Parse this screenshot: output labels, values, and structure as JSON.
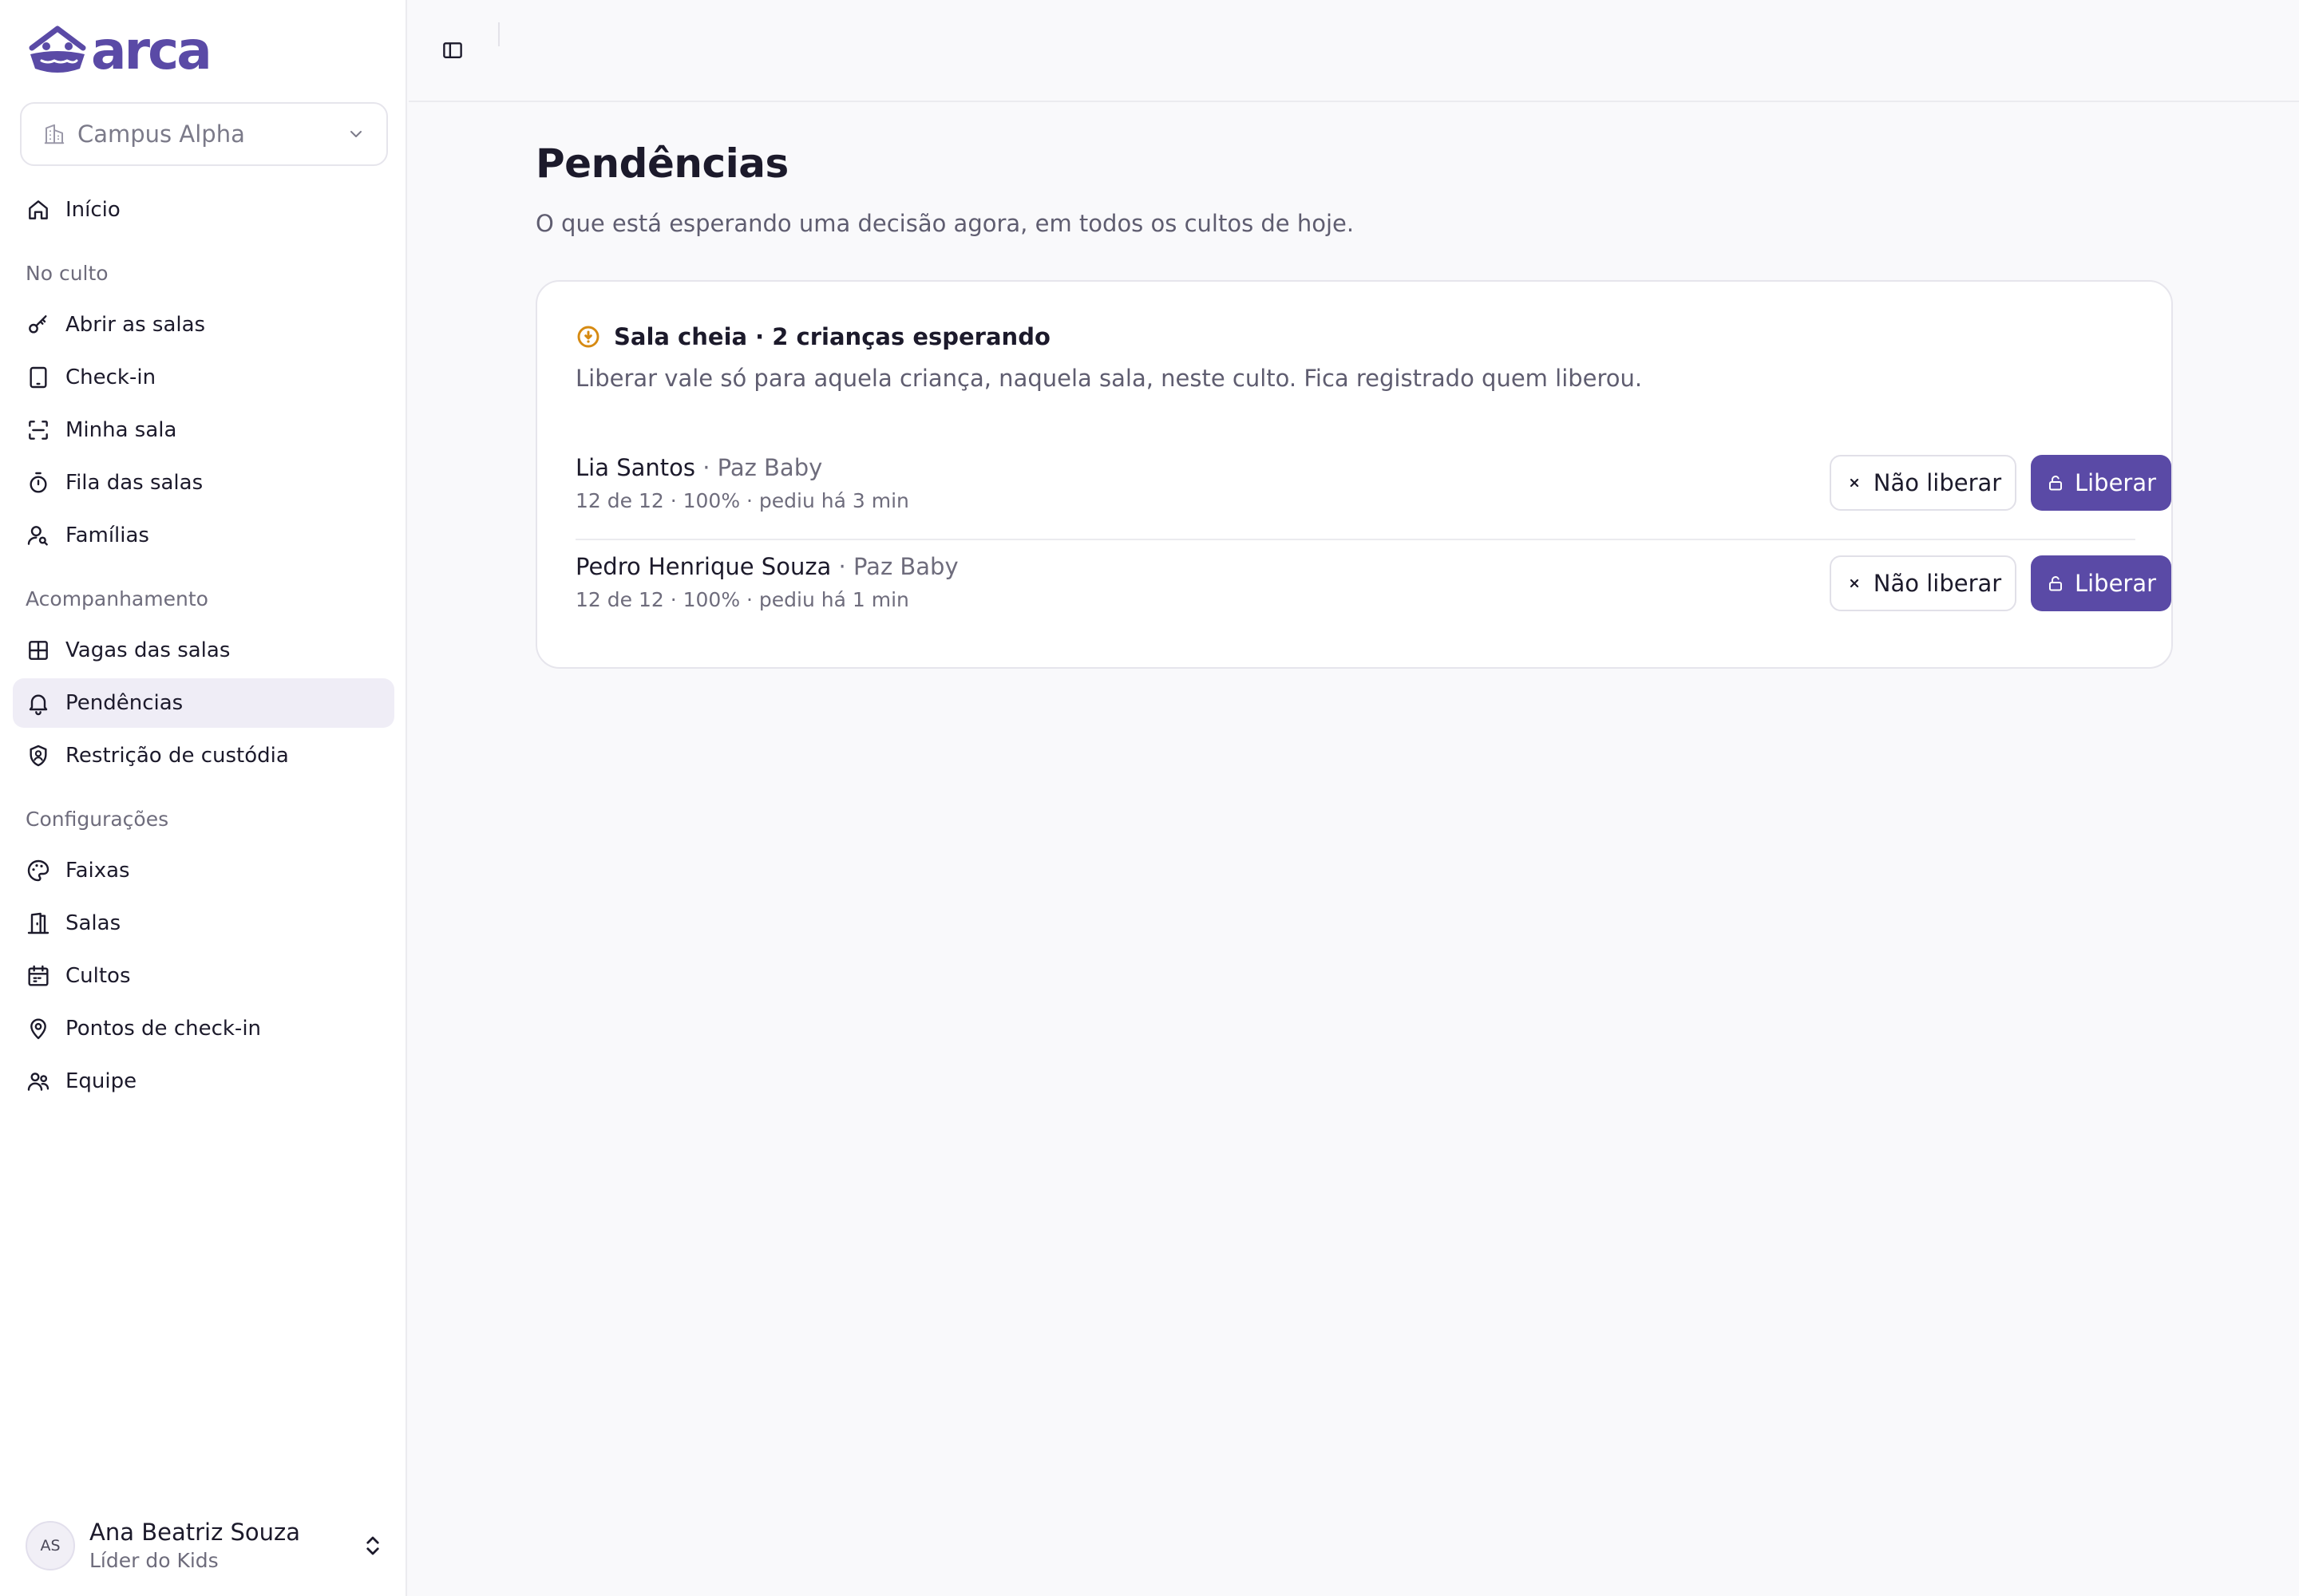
{
  "app": {
    "brand": "arca",
    "accent": "#5a4aa6",
    "warning": "#d68a12"
  },
  "campus": {
    "label": "Campus Alpha",
    "icon": "building-icon"
  },
  "nav": {
    "home": {
      "label": "Início",
      "icon": "home-icon"
    },
    "sections": [
      {
        "title": "No culto",
        "items": [
          {
            "label": "Abrir as salas",
            "icon": "key-icon"
          },
          {
            "label": "Check-in",
            "icon": "tablet-icon"
          },
          {
            "label": "Minha sala",
            "icon": "scan-icon"
          },
          {
            "label": "Fila das salas",
            "icon": "timer-icon"
          },
          {
            "label": "Famílias",
            "icon": "user-search-icon"
          }
        ]
      },
      {
        "title": "Acompanhamento",
        "items": [
          {
            "label": "Vagas das salas",
            "icon": "grid-icon"
          },
          {
            "label": "Pendências",
            "icon": "bell-icon",
            "active": true
          },
          {
            "label": "Restrição de custódia",
            "icon": "shield-user-icon"
          }
        ]
      },
      {
        "title": "Configurações",
        "items": [
          {
            "label": "Faixas",
            "icon": "palette-icon"
          },
          {
            "label": "Salas",
            "icon": "door-icon"
          },
          {
            "label": "Cultos",
            "icon": "calendar-icon"
          },
          {
            "label": "Pontos de check-in",
            "icon": "map-pin-icon"
          },
          {
            "label": "Equipe",
            "icon": "team-icon"
          }
        ]
      }
    ]
  },
  "user": {
    "initials": "AS",
    "name": "Ana Beatriz Souza",
    "role": "Líder do Kids"
  },
  "page": {
    "title": "Pendências",
    "subtitle": "O que está esperando uma decisão agora, em todos os cultos de hoje."
  },
  "alert": {
    "title": "Sala cheia · 2 crianças esperando",
    "description": "Liberar vale só para aquela criança, naquela sala, neste culto. Fica registrado quem liberou.",
    "icon": "warning-circle-icon",
    "requests": [
      {
        "name": "Lia Santos",
        "room": " · Paz Baby",
        "meta": "12 de 12 · 100% · pediu há 3 min",
        "deny_label": "Não liberar",
        "allow_label": "Liberar"
      },
      {
        "name": "Pedro Henrique Souza",
        "room": " · Paz Baby",
        "meta": "12 de 12 · 100% · pediu há 1 min",
        "deny_label": "Não liberar",
        "allow_label": "Liberar"
      }
    ]
  }
}
